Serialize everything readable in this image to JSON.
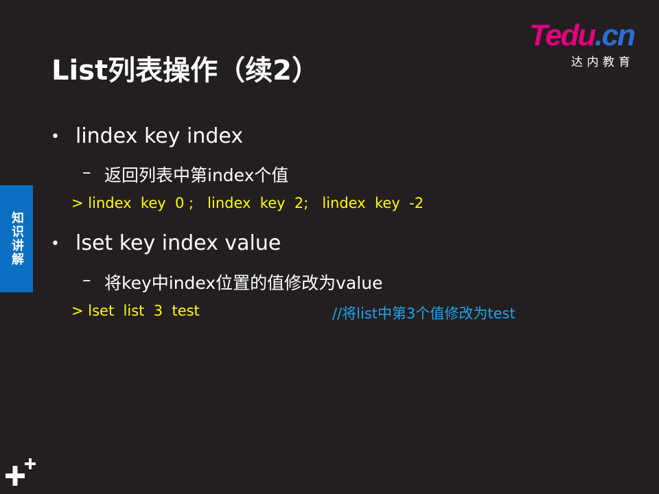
{
  "slide": {
    "title": "List列表操作（续2）"
  },
  "logo": {
    "brand": "Tedu.cn",
    "brand_main": "Tedu",
    "brand_suffix": ".cn",
    "subtitle": "达内教育"
  },
  "side_tab": {
    "label": "知识讲解"
  },
  "content": {
    "bullets": [
      {
        "text": "lindex key index",
        "sub": "返回列表中第index个值",
        "code": "> lindex  key  0 ;   lindex  key  2;   lindex  key  -2",
        "comment": ""
      },
      {
        "text": "lset key index value",
        "sub": "将key中index位置的值修改为value",
        "code": "> lset  list  3  test",
        "comment": "//将list中第3个值修改为test"
      }
    ],
    "bullet_glyph": "•",
    "dash_glyph": "–"
  },
  "colors": {
    "background": "#231f20",
    "code": "#ffff00",
    "comment": "#1ea5f0",
    "tab": "#0b6fc1",
    "brand": "#e4007f"
  },
  "icons": {
    "corner": "plus-icon"
  }
}
